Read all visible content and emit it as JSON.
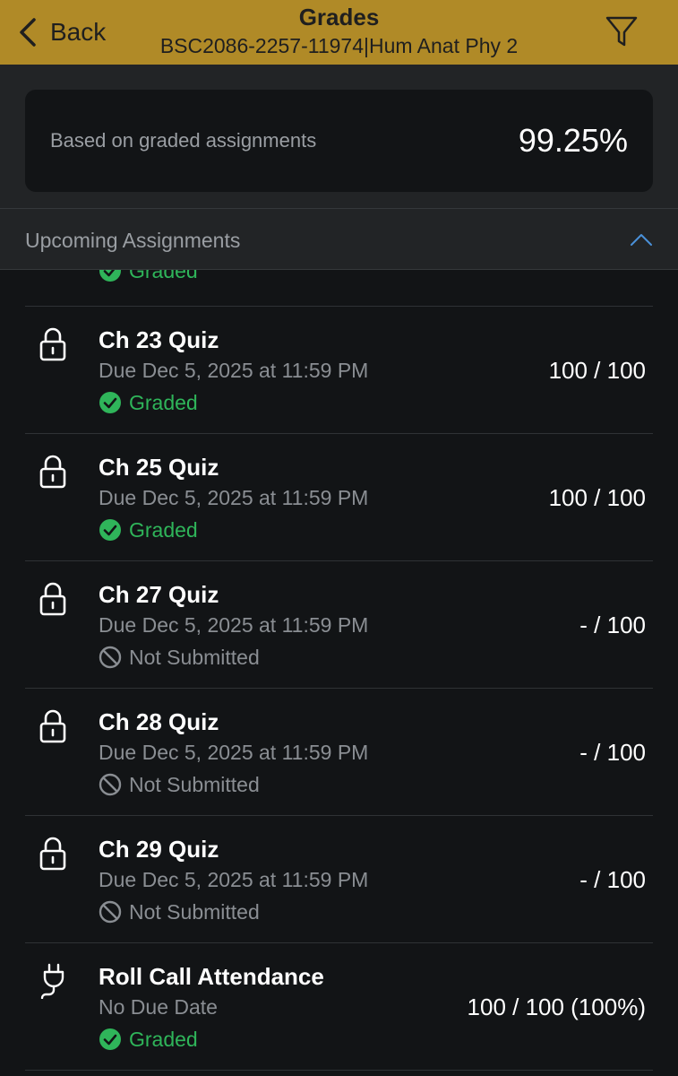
{
  "header": {
    "back_label": "Back",
    "title": "Grades",
    "subtitle": "BSC2086-2257-11974|Hum Anat  Phy 2",
    "bar_color": "#b08a27",
    "filter_icon": "filter-icon"
  },
  "summary": {
    "label": "Based on graded assignments",
    "value": "99.25%"
  },
  "section": {
    "title": "Upcoming Assignments",
    "expanded": true
  },
  "partial_row": {
    "status": "Graded"
  },
  "assignments": [
    {
      "icon": "lock-icon",
      "title": "Ch 23 Quiz",
      "due": "Due Dec 5, 2025 at 11:59 PM",
      "status": "Graded",
      "status_type": "graded",
      "score": "100 / 100"
    },
    {
      "icon": "lock-icon",
      "title": "Ch 25 Quiz",
      "due": "Due Dec 5, 2025 at 11:59 PM",
      "status": "Graded",
      "status_type": "graded",
      "score": "100 / 100"
    },
    {
      "icon": "lock-icon",
      "title": "Ch 27 Quiz",
      "due": "Due Dec 5, 2025 at 11:59 PM",
      "status": "Not Submitted",
      "status_type": "not-submitted",
      "score": "- / 100"
    },
    {
      "icon": "lock-icon",
      "title": "Ch 28 Quiz",
      "due": "Due Dec 5, 2025 at 11:59 PM",
      "status": "Not Submitted",
      "status_type": "not-submitted",
      "score": "- / 100"
    },
    {
      "icon": "lock-icon",
      "title": "Ch 29 Quiz",
      "due": "Due Dec 5, 2025 at 11:59 PM",
      "status": "Not Submitted",
      "status_type": "not-submitted",
      "score": "- / 100"
    },
    {
      "icon": "plug-icon",
      "title": "Roll Call Attendance",
      "due": "No Due Date",
      "status": "Graded",
      "status_type": "graded",
      "score": "100 / 100 (100%)"
    }
  ],
  "colors": {
    "graded": "#2fb55a",
    "muted": "#8a8e93",
    "accent": "#4a90d9"
  }
}
